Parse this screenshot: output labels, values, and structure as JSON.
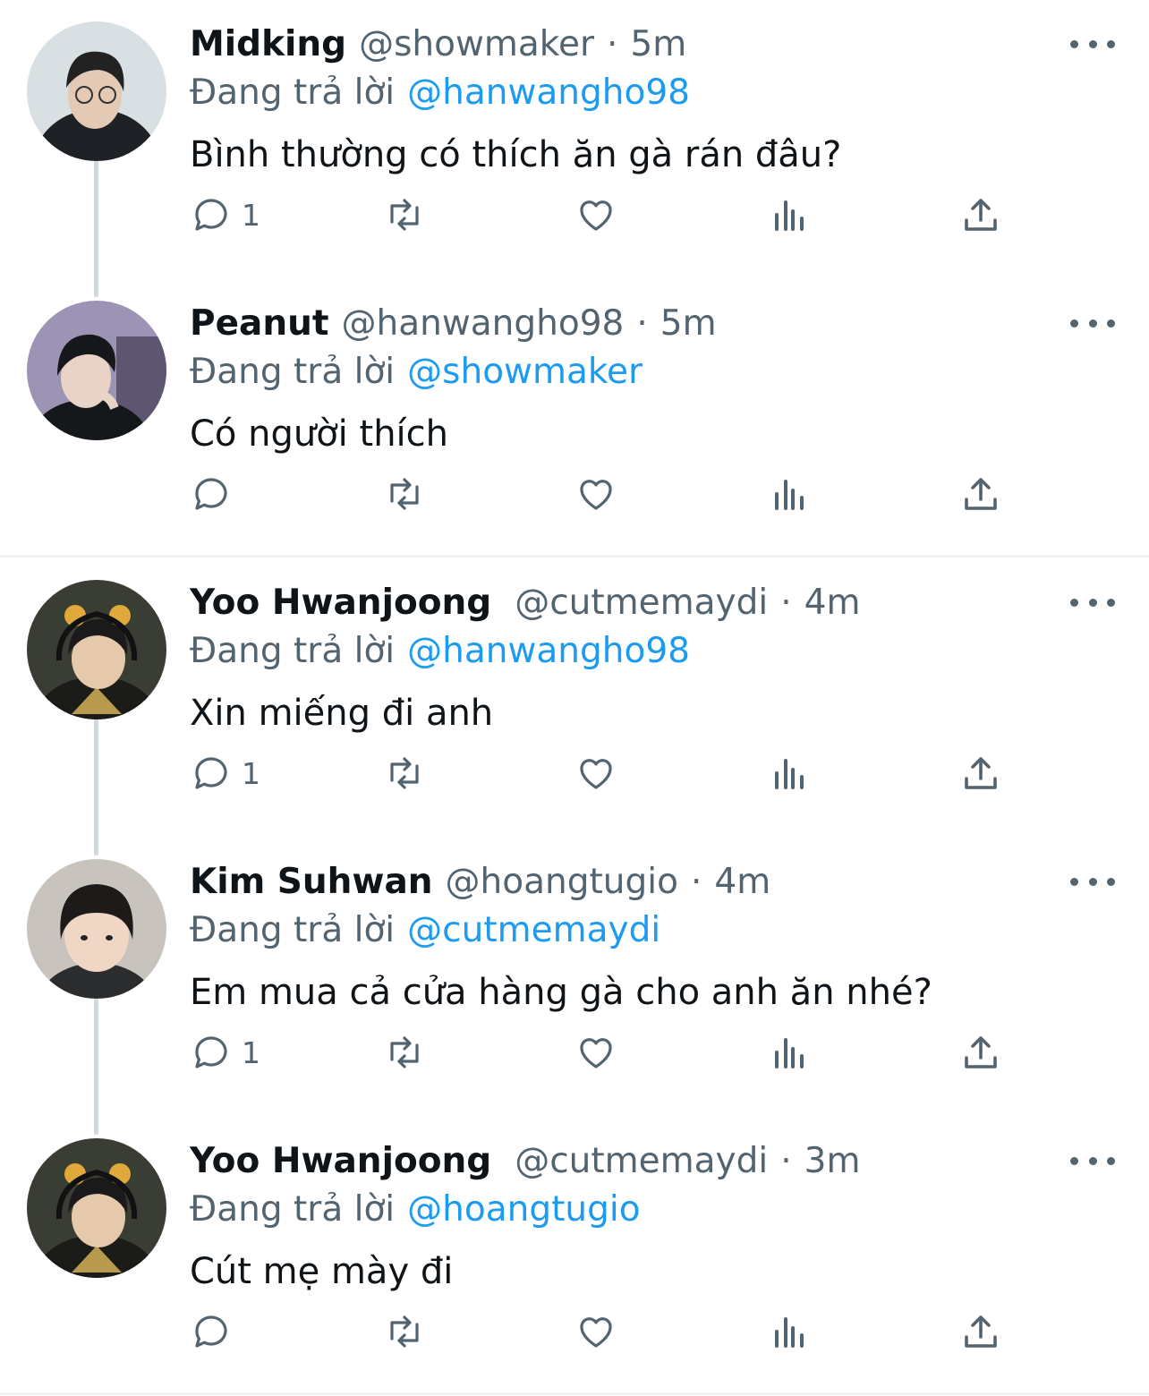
{
  "tweets": [
    {
      "name": "Midking",
      "handle": "@showmaker",
      "dot": "·",
      "time": "5m",
      "replying_prefix": "Đang trả lời",
      "replying_to": "@hanwangho98",
      "text": "Bình thường có thích ăn gà rán đâu?",
      "reply_count": "1",
      "avatar_bg": "#d9e0e3"
    },
    {
      "name": "Peanut",
      "handle": "@hanwangho98",
      "dot": "·",
      "time": "5m",
      "replying_prefix": "Đang trả lời",
      "replying_to": "@showmaker",
      "text": "Có người thích",
      "reply_count": "",
      "avatar_bg": "#9d93b4"
    },
    {
      "name": "Yoo Hwanjoong",
      "handle": "@cutmemaydi",
      "dot": "·",
      "time": "4m",
      "replying_prefix": "Đang trả lời",
      "replying_to": "@hanwangho98",
      "text": "Xin miếng đi anh",
      "reply_count": "1",
      "avatar_bg": "#3a3d33"
    },
    {
      "name": "Kim Suhwan",
      "handle": "@hoangtugio",
      "dot": "·",
      "time": "4m",
      "replying_prefix": "Đang trả lời",
      "replying_to": "@cutmemaydi",
      "text": "Em mua cả cửa hàng gà cho anh ăn nhé?",
      "reply_count": "1",
      "avatar_bg": "#c9c3bd"
    },
    {
      "name": "Yoo Hwanjoong",
      "handle": "@cutmemaydi",
      "dot": "·",
      "time": "3m",
      "replying_prefix": "Đang trả lời",
      "replying_to": "@hoangtugio",
      "text": "Cút mẹ mày đi",
      "reply_count": "",
      "avatar_bg": "#3a3d33"
    }
  ],
  "colors": {
    "text_primary": "#0f1419",
    "text_secondary": "#536471",
    "accent": "#1d9bf0",
    "thread_line": "#cfd9de",
    "divider": "#eff3f4"
  },
  "icons": {
    "reply": "reply-icon",
    "retweet": "retweet-icon",
    "like": "heart-icon",
    "views": "analytics-icon",
    "share": "share-icon",
    "more": "more-icon"
  }
}
